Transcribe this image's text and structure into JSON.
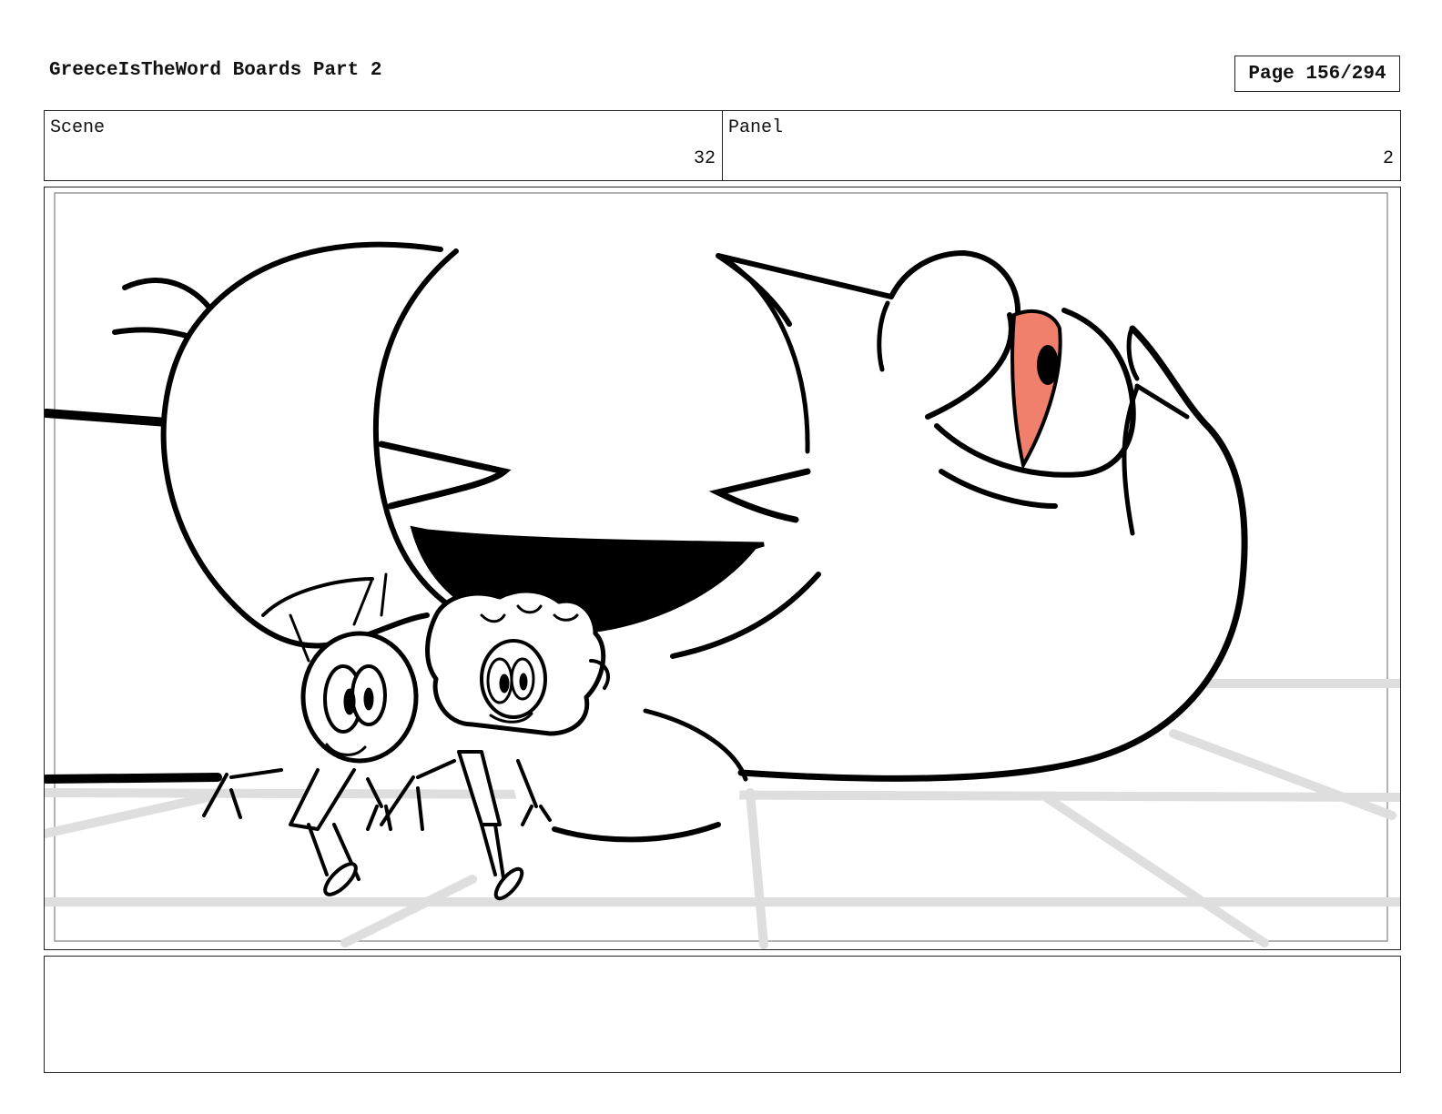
{
  "header": {
    "title": "GreeceIsTheWord Boards Part 2",
    "page_label": "Page 156/294"
  },
  "info": {
    "scene_label": "Scene",
    "scene_value": "32",
    "panel_label": "Panel",
    "panel_value": "2"
  },
  "panel_image": {
    "description_icon": "storyboard-drawing",
    "eye_color": "#f07f6c"
  },
  "notes": {
    "text": ""
  }
}
